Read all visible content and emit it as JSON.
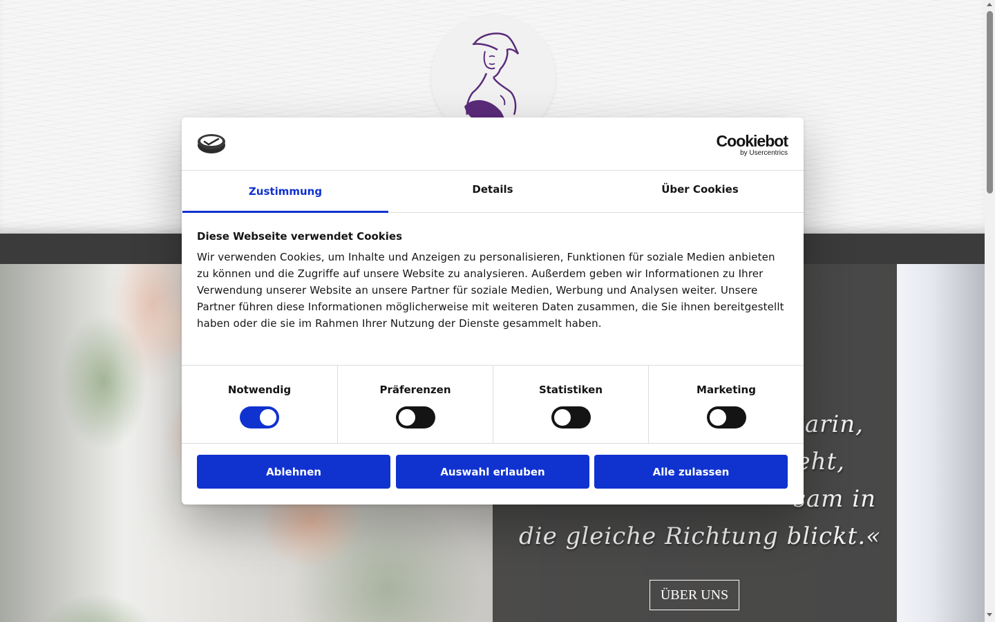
{
  "background_page": {
    "hero_quote_lines": [
      "darin,",
      "ieht,",
      "sam in",
      "die gleiche Richtung blickt.«"
    ],
    "about_button_label": "ÜBER UNS"
  },
  "cookie_dialog": {
    "brand": {
      "wordmark": "Cookiebot",
      "sub": "by Usercentrics"
    },
    "tabs": [
      {
        "label": "Zustimmung",
        "active": true
      },
      {
        "label": "Details",
        "active": false
      },
      {
        "label": "Über Cookies",
        "active": false
      }
    ],
    "title": "Diese Webseite verwendet Cookies",
    "text": "Wir verwenden Cookies, um Inhalte und Anzeigen zu personalisieren, Funktionen für soziale Medien anbieten zu können und die Zugriffe auf unsere Website zu analysieren. Außerdem geben wir Informationen zu Ihrer Verwendung unserer Website an unsere Partner für soziale Medien, Werbung und Analysen weiter. Unsere Partner führen diese Informationen möglicherweise mit weiteren Daten zusammen, die Sie ihnen bereitgestellt haben oder die sie im Rahmen Ihrer Nutzung der Dienste gesammelt haben.",
    "categories": [
      {
        "label": "Notwendig",
        "enabled": true
      },
      {
        "label": "Präferenzen",
        "enabled": false
      },
      {
        "label": "Statistiken",
        "enabled": false
      },
      {
        "label": "Marketing",
        "enabled": false
      }
    ],
    "buttons": [
      {
        "label": "Ablehnen"
      },
      {
        "label": "Auswahl erlauben"
      },
      {
        "label": "Alle zulassen"
      }
    ]
  },
  "colors": {
    "accent": "#1032cf",
    "toggle_off": "#141414",
    "nav_bar": "#3b3b3b",
    "logo_purple": "#5b2b7a"
  },
  "icons": [
    "woman-logo-icon",
    "site-logo-icon",
    "cookiebot-logo"
  ]
}
